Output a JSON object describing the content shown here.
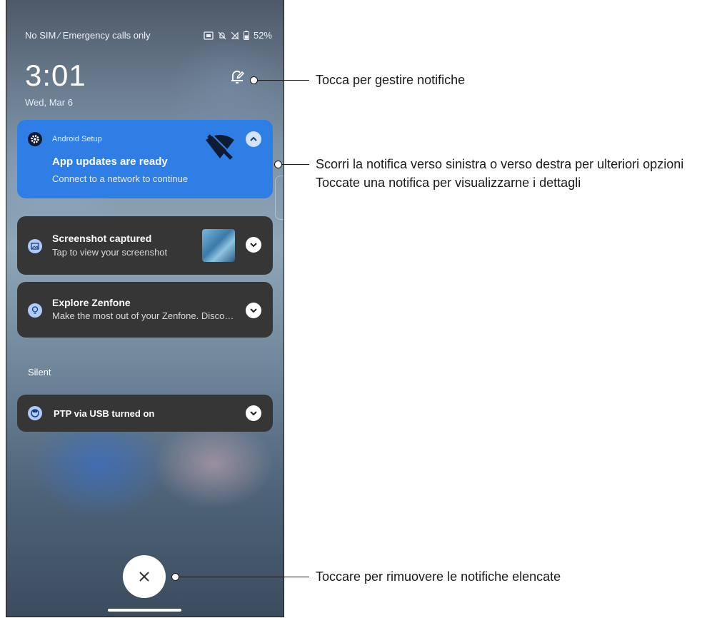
{
  "status_bar": {
    "carrier": "No SIM ⁄ Emergency calls only",
    "battery": "52%"
  },
  "lockscreen": {
    "time": "3:01",
    "date": "Wed, Mar 6"
  },
  "notifications": [
    {
      "app": "Android Setup",
      "title": "App updates are ready",
      "text": "Connect to a network to continue",
      "icon": "gear-icon",
      "color": "#2f7ee6"
    },
    {
      "title": "Screenshot captured",
      "text": "Tap to view your screenshot",
      "icon": "image-icon"
    },
    {
      "title": "Explore Zenfone",
      "text": "Make the most out of your Zenfone. Disco…",
      "icon": "lightbulb-icon"
    }
  ],
  "silent_section": {
    "label": "Silent",
    "notification": {
      "title": "PTP via USB turned on",
      "icon": "usb-icon"
    }
  },
  "callouts": {
    "manage": "Tocca per gestire notifiche",
    "swipe_line1": "Scorri la notifica verso sinistra o verso destra per ulteriori opzioni",
    "swipe_line2": "Toccate una notifica per visualizzarne i dettagli",
    "clear": "Toccare per rimuovere le notifiche elencate"
  }
}
